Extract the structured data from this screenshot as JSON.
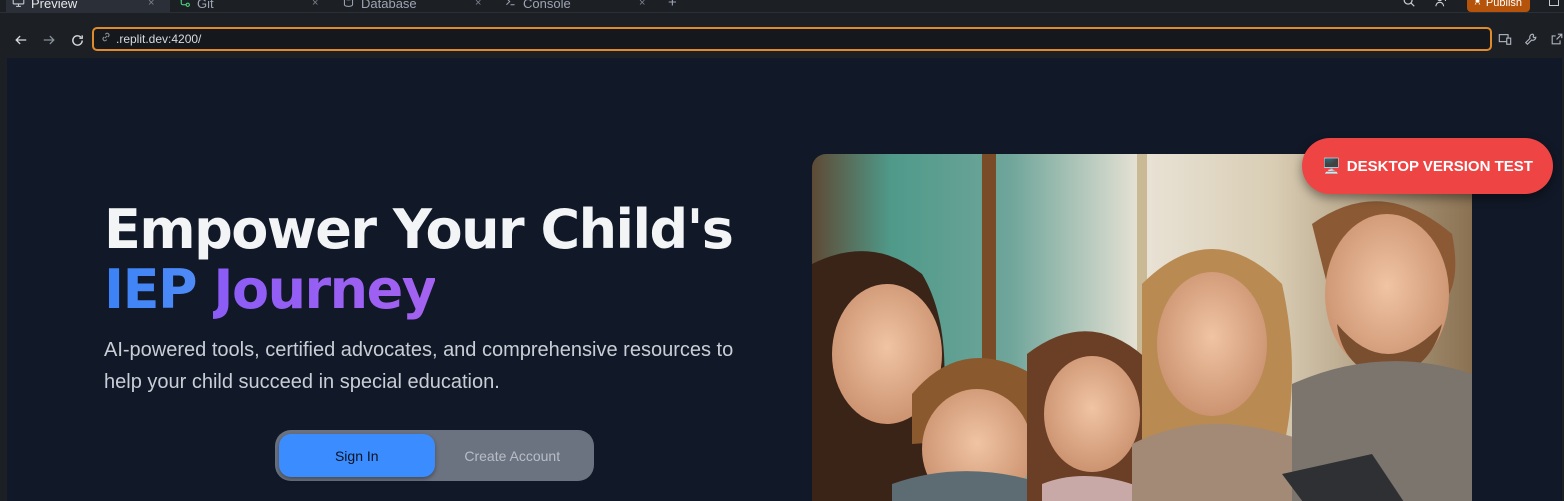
{
  "ide": {
    "tabs": [
      {
        "label": "Preview",
        "icon": "monitor-icon",
        "active": true
      },
      {
        "label": "Git",
        "icon": "git-icon",
        "active": false
      },
      {
        "label": "Database",
        "icon": "database-icon",
        "active": false
      },
      {
        "label": "Console",
        "icon": "terminal-icon",
        "active": false
      }
    ],
    "close_glyph": "×",
    "add_tab_glyph": "+",
    "publish_label": "Publish"
  },
  "browser": {
    "url": ".replit.dev:4200/"
  },
  "hero": {
    "title_line1": "Empower Your Child's",
    "title_word_blue": "IEP",
    "title_word_purple": "Journey",
    "subtitle": "AI-powered tools, certified advocates, and comprehensive resources to help your child succeed in special education.",
    "signin_label": "Sign In",
    "create_label": "Create Account"
  },
  "badge": {
    "icon": "🖥️",
    "label": "DESKTOP VERSION TEST"
  },
  "colors": {
    "page_bg": "#111827",
    "accent_blue": "#3b82f6",
    "accent_purple": "#8b5cf6",
    "badge_red": "#ef4444",
    "url_focus": "#e08a2a",
    "publish": "#b45309"
  }
}
